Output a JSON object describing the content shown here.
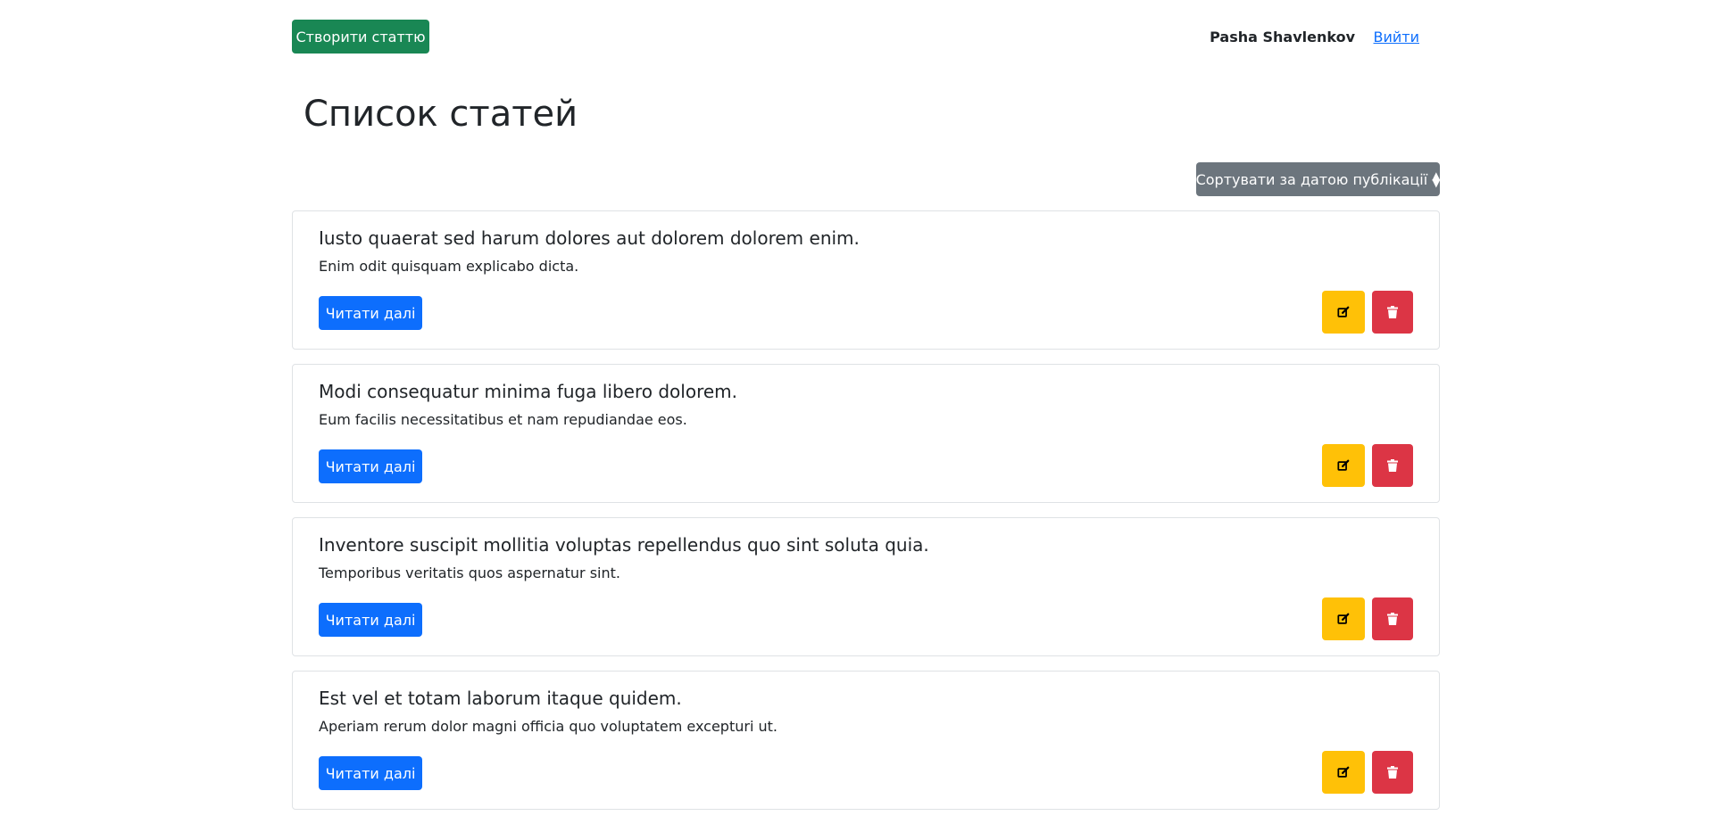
{
  "header": {
    "create_label": "Створити статтю",
    "user_name": "Pasha Shavlenkov",
    "logout_label": "Вийти"
  },
  "page": {
    "title": "Список статей",
    "sort_label": "Сортувати за датою публікації"
  },
  "articles": [
    {
      "title": "Iusto quaerat sed harum dolores aut dolorem dolorem enim.",
      "excerpt": "Enim odit quisquam explicabo dicta.",
      "read_more": "Читати далі"
    },
    {
      "title": "Modi consequatur minima fuga libero dolorem.",
      "excerpt": "Eum facilis necessitatibus et nam repudiandae eos.",
      "read_more": "Читати далі"
    },
    {
      "title": "Inventore suscipit mollitia voluptas repellendus quo sint soluta quia.",
      "excerpt": "Temporibus veritatis quos aspernatur sint.",
      "read_more": "Читати далі"
    },
    {
      "title": "Est vel et totam laborum itaque quidem.",
      "excerpt": "Aperiam rerum dolor magni officia quo voluptatem excepturi ut.",
      "read_more": "Читати далі"
    }
  ],
  "icons": {
    "sort": "sort-icon",
    "edit": "edit-icon",
    "delete": "trash-icon"
  },
  "colors": {
    "create": "#198754",
    "sort": "#6c757d",
    "read_more": "#0d6efd",
    "edit": "#ffc107",
    "delete": "#dc3545",
    "link": "#0d6efd"
  }
}
